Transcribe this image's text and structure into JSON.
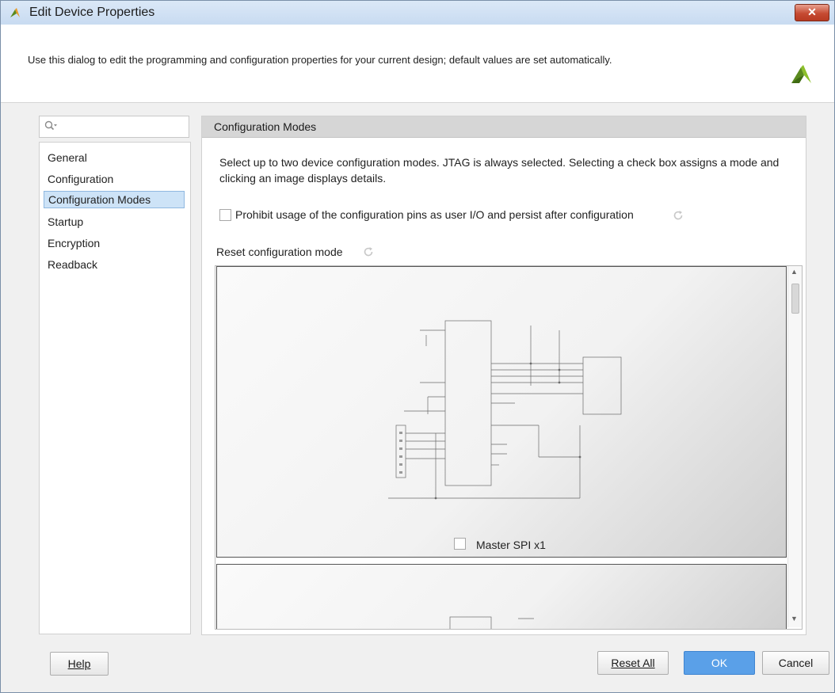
{
  "window": {
    "title": "Edit Device Properties",
    "close_label": "✕"
  },
  "header": {
    "description": "Use this dialog to edit the programming and configuration properties for your current design; default values are set automatically."
  },
  "search": {
    "placeholder": ""
  },
  "sidebar": {
    "items": [
      {
        "label": "General"
      },
      {
        "label": "Configuration"
      },
      {
        "label": "Configuration Modes",
        "selected": true
      },
      {
        "label": "Startup"
      },
      {
        "label": "Encryption"
      },
      {
        "label": "Readback"
      }
    ]
  },
  "panel": {
    "title": "Configuration Modes",
    "description": "Select up to two device configuration modes. JTAG is always selected. Selecting a check box assigns a mode and clicking an image displays details.",
    "prohibit_label": "Prohibit usage of the configuration pins as user I/O and persist after configuration",
    "prohibit_checked": false,
    "reset_label": "Reset configuration mode",
    "modes": [
      {
        "label": "Master SPI x1",
        "checked": false
      }
    ]
  },
  "footer": {
    "help_label": "Help",
    "reset_all_label": "Reset All",
    "ok_label": "OK",
    "cancel_label": "Cancel"
  },
  "colors": {
    "accent": "#5aa0e8",
    "selection": "#cde3f7",
    "logo_green": "#5a8a1e",
    "logo_orange": "#e89a2a"
  },
  "icons": [
    "app-logo-icon",
    "close-icon",
    "search-icon",
    "refresh-icon",
    "scroll-up-icon",
    "scroll-down-icon"
  ]
}
